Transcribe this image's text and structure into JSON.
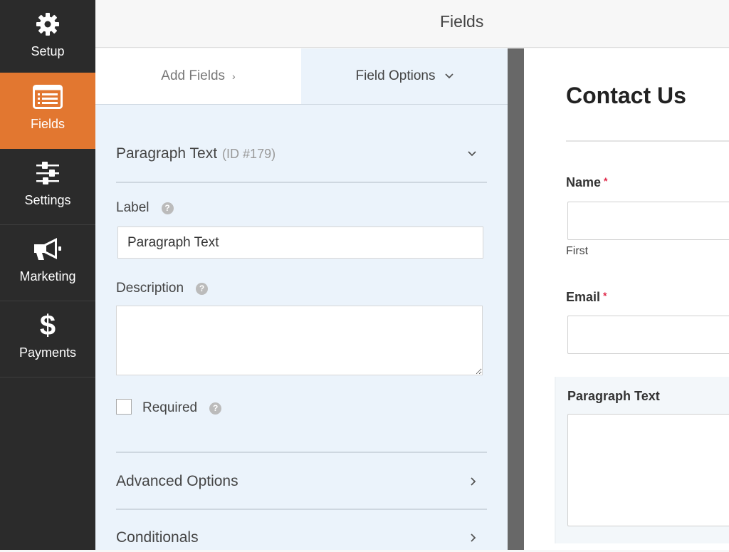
{
  "sidebar": {
    "items": [
      {
        "label": "Setup",
        "icon": "gear-icon",
        "active": false
      },
      {
        "label": "Fields",
        "icon": "list-icon",
        "active": true
      },
      {
        "label": "Settings",
        "icon": "sliders-icon",
        "active": false
      },
      {
        "label": "Marketing",
        "icon": "megaphone-icon",
        "active": false
      },
      {
        "label": "Payments",
        "icon": "dollar-icon",
        "active": false
      }
    ],
    "accent": "#e27730"
  },
  "header": {
    "title": "Fields"
  },
  "panel": {
    "tabs": [
      {
        "label": "Add Fields",
        "chevron": "›"
      },
      {
        "label": "Field Options",
        "chevron": "⌄"
      }
    ],
    "field": {
      "name": "Paragraph Text",
      "id": "(ID #179)"
    },
    "label_field": {
      "label": "Label",
      "value": "Paragraph Text"
    },
    "description_field": {
      "label": "Description",
      "value": ""
    },
    "required": {
      "label": "Required",
      "checked": false
    },
    "sections": [
      {
        "label": "Advanced Options"
      },
      {
        "label": "Conditionals"
      }
    ],
    "help_glyph": "?"
  },
  "preview": {
    "title": "Contact Us",
    "fields": [
      {
        "label": "Name",
        "required": "*",
        "sublabel": "First"
      },
      {
        "label": "Email",
        "required": "*"
      },
      {
        "label": "Paragraph Text"
      }
    ]
  }
}
